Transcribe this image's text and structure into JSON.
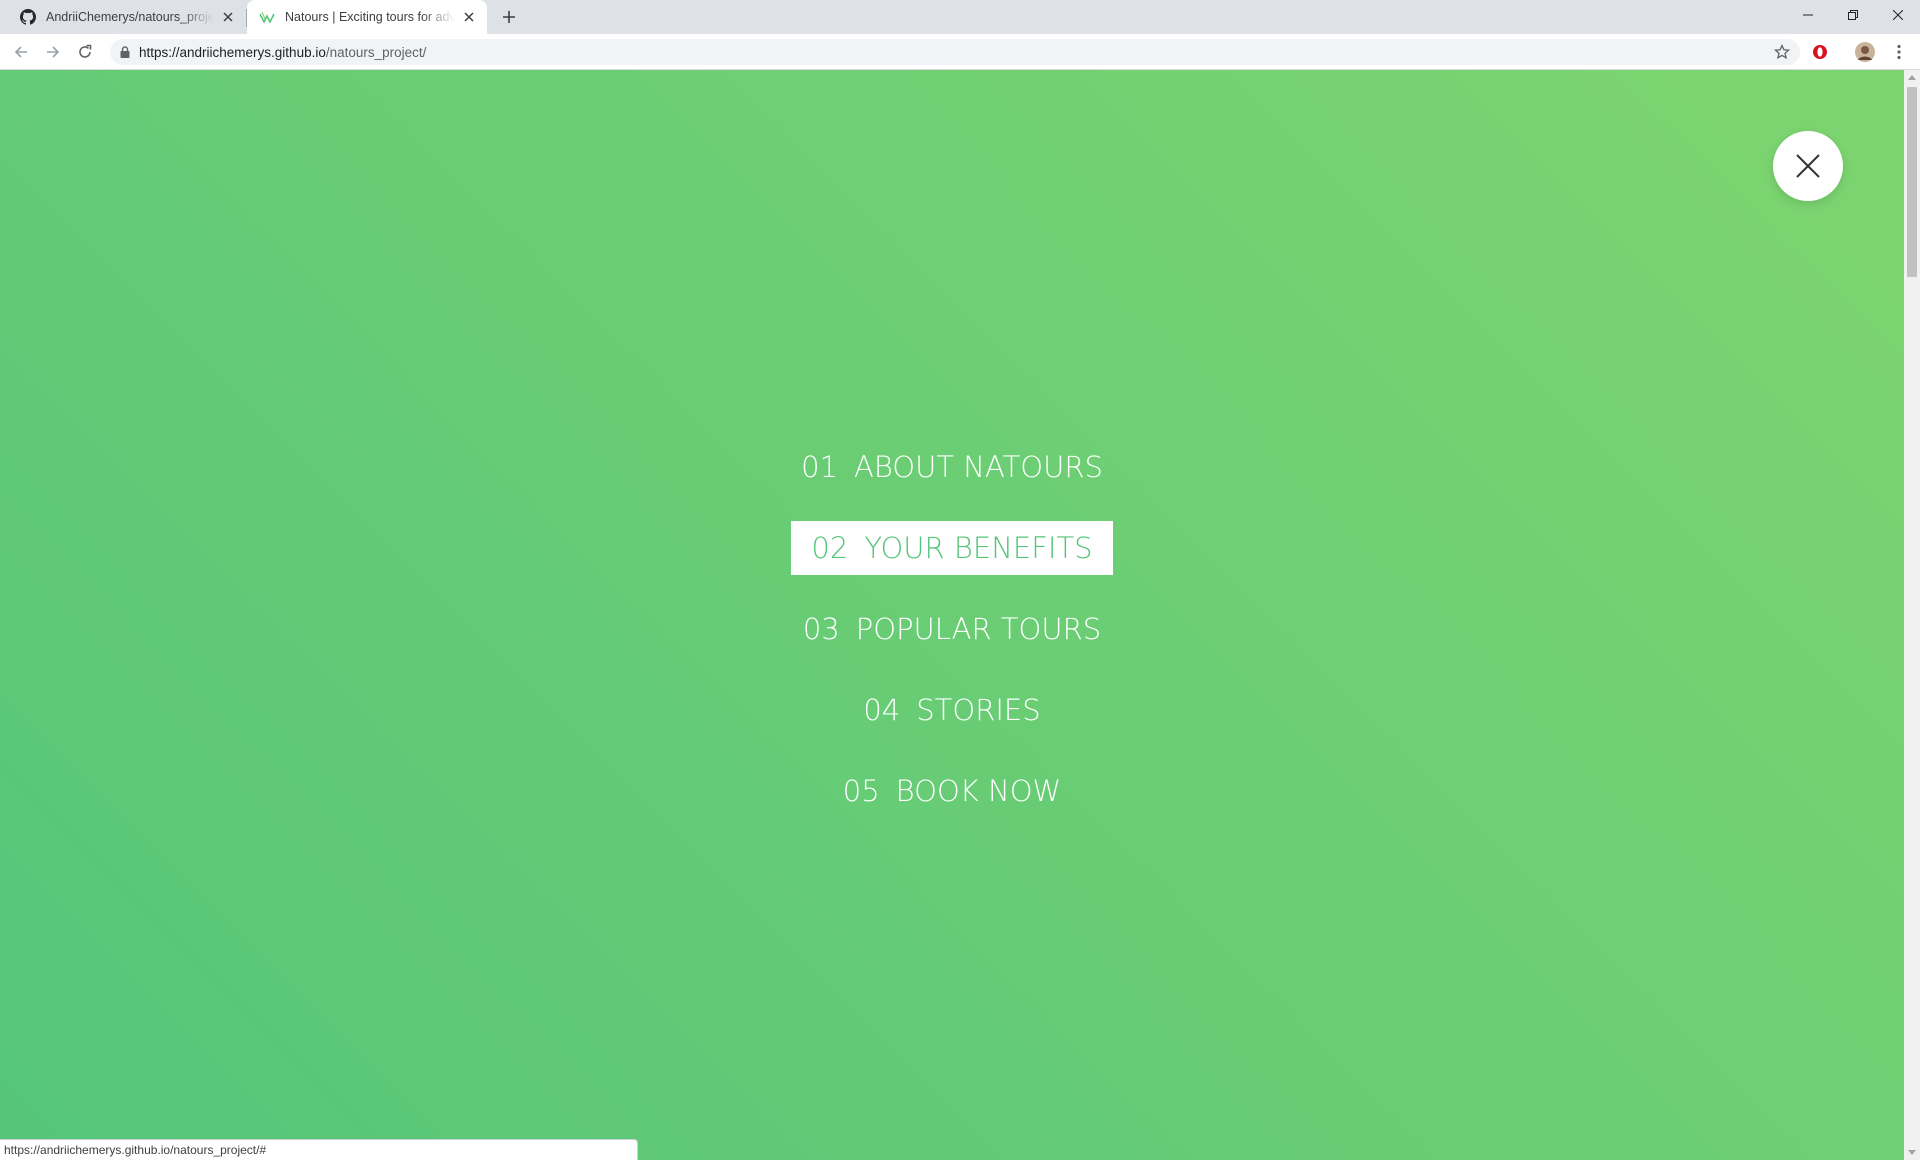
{
  "browser": {
    "tabs": [
      {
        "title": "AndriiChemerys/natours_project:",
        "favicon": "github-icon",
        "active": false
      },
      {
        "title": "Natours | Exciting tours for adve",
        "favicon": "natours-logo-icon",
        "active": true
      }
    ],
    "address_bar": {
      "url_host": "https://andriichemerys.github.io",
      "url_path": "/natours_project/"
    },
    "status_url": "https://andriichemerys.github.io/natours_project/#"
  },
  "page": {
    "nav_items": [
      {
        "number": "01",
        "label": "About Natours",
        "active": false
      },
      {
        "number": "02",
        "label": "Your benefits",
        "active": true
      },
      {
        "number": "03",
        "label": "Popular tours",
        "active": false
      },
      {
        "number": "04",
        "label": "Stories",
        "active": false
      },
      {
        "number": "05",
        "label": "Book now",
        "active": false
      }
    ],
    "colors": {
      "gradient_light": "#7ed56f",
      "gradient_dark": "#55c57a",
      "active_text": "#55c57a"
    }
  }
}
